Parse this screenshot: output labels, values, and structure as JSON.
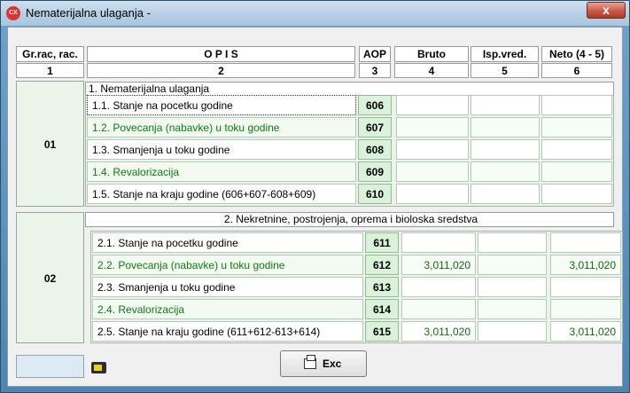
{
  "window": {
    "title": "Nematerijalna ulaganja -",
    "app_icon": "CX",
    "close_label": "x"
  },
  "header": {
    "columns": [
      "Gr.rac, rac.",
      "O P I S",
      "AOP",
      "Bruto",
      "Isp.vred.",
      "Neto (4 - 5)"
    ],
    "numbers": [
      "1",
      "2",
      "3",
      "4",
      "5",
      "6"
    ]
  },
  "sections": [
    {
      "group": "01",
      "title": "1. Nematerijalna ulaganja",
      "rows": [
        {
          "label": "1.1. Stanje na pocetku godine",
          "aop": "606",
          "bruto": "",
          "isp": "",
          "neto": ""
        },
        {
          "label": "1.2. Povecanja (nabavke) u toku godine",
          "aop": "607",
          "bruto": "",
          "isp": "",
          "neto": ""
        },
        {
          "label": "1.3. Smanjenja u toku godine",
          "aop": "608",
          "bruto": "",
          "isp": "",
          "neto": ""
        },
        {
          "label": "1.4. Revalorizacija",
          "aop": "609",
          "bruto": "",
          "isp": "",
          "neto": ""
        },
        {
          "label": "1.5. Stanje na kraju godine (606+607-608+609)",
          "aop": "610",
          "bruto": "",
          "isp": "",
          "neto": ""
        }
      ]
    },
    {
      "group": "02",
      "title": "2. Nekretnine, postrojenja, oprema i bioloska sredstva",
      "rows": [
        {
          "label": "2.1. Stanje na pocetku godine",
          "aop": "611",
          "bruto": "",
          "isp": "",
          "neto": ""
        },
        {
          "label": "2.2. Povecanja (nabavke) u toku godine",
          "aop": "612",
          "bruto": "3,011,020",
          "isp": "",
          "neto": "3,011,020"
        },
        {
          "label": "2.3. Smanjenja u toku godine",
          "aop": "613",
          "bruto": "",
          "isp": "",
          "neto": ""
        },
        {
          "label": "2.4. Revalorizacija",
          "aop": "614",
          "bruto": "",
          "isp": "",
          "neto": ""
        },
        {
          "label": "2.5. Stanje na kraju godine (611+612-613+614)",
          "aop": "615",
          "bruto": "3,011,020",
          "isp": "",
          "neto": "3,011,020"
        }
      ]
    }
  ],
  "footer": {
    "exc_label": "Exc"
  },
  "colors": {
    "green_text": "#0f7a0f",
    "aop_bg": "#d9f2d9",
    "title_bar": "#b8d0e6"
  }
}
